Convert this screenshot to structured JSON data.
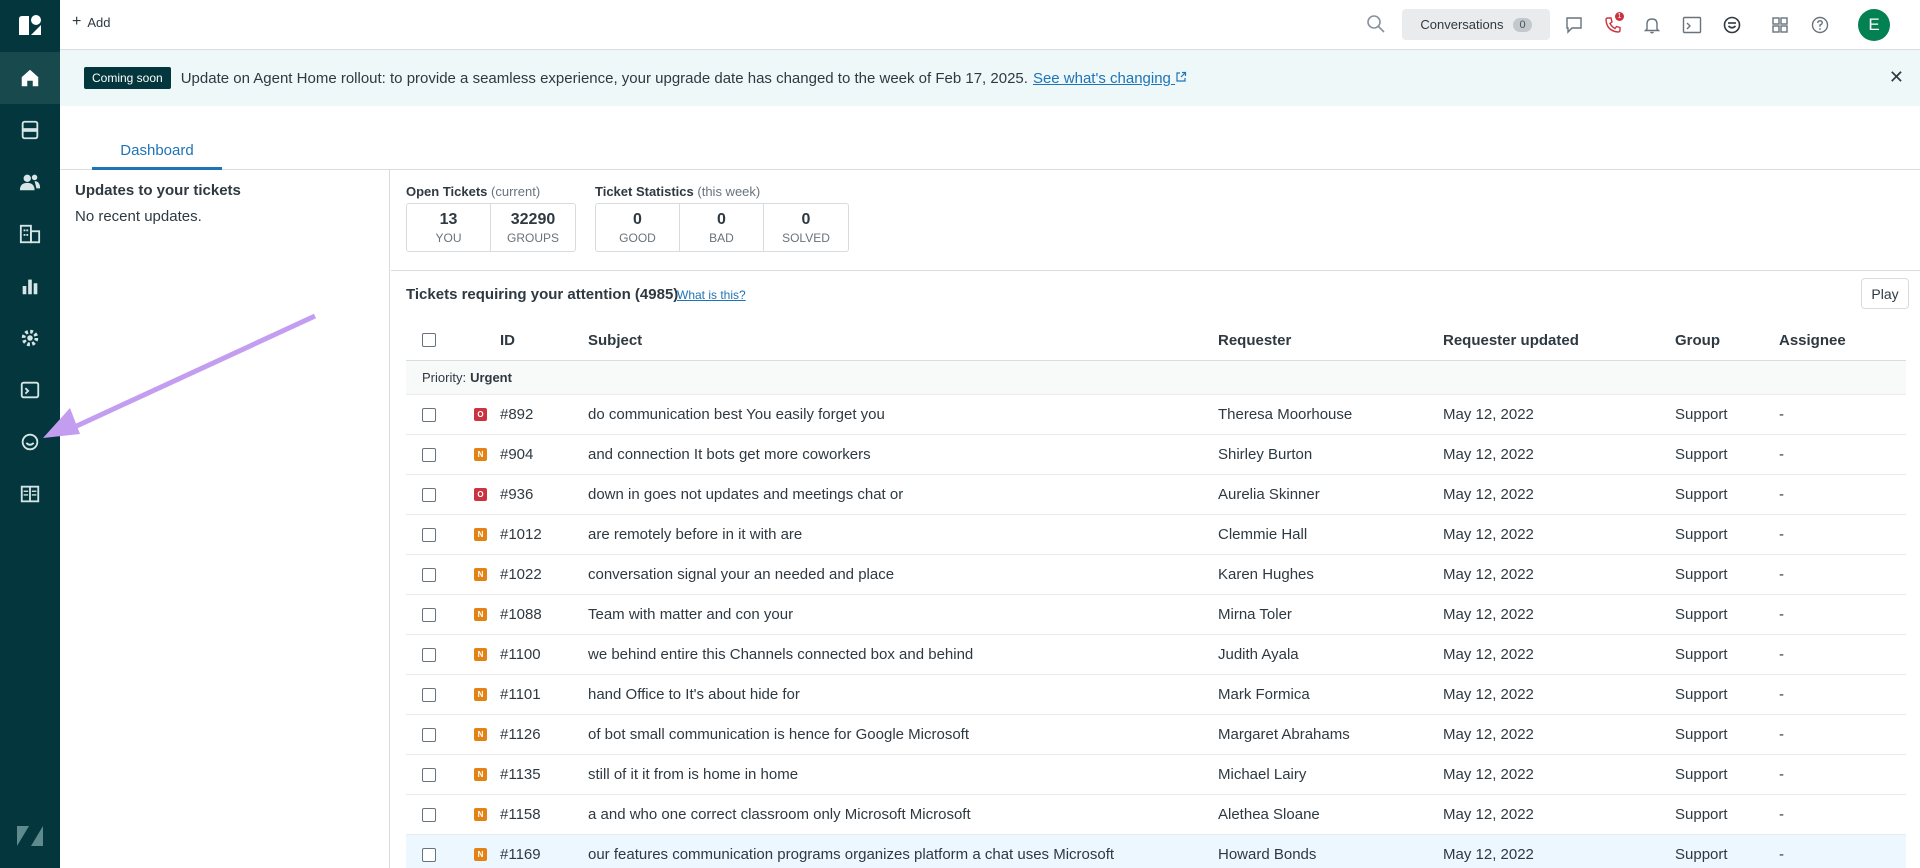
{
  "topbar": {
    "add_label": "Add",
    "conversations_label": "Conversations",
    "conversations_count": "0",
    "phone_badge": "1",
    "avatar_initial": "E"
  },
  "banner": {
    "tag": "Coming soon",
    "text": "Update on Agent Home rollout: to provide a seamless experience, your upgrade date has changed to the week of Feb 17, 2025.",
    "link": "See what's changing"
  },
  "tabs": {
    "dashboard": "Dashboard"
  },
  "updates": {
    "title": "Updates to your tickets",
    "text": "No recent updates."
  },
  "open_tickets": {
    "label": "Open Tickets",
    "qualifier": "(current)",
    "boxes": [
      {
        "value": "13",
        "label": "YOU"
      },
      {
        "value": "32290",
        "label": "GROUPS"
      }
    ]
  },
  "ticket_stats": {
    "label": "Ticket Statistics",
    "qualifier": "(this week)",
    "boxes": [
      {
        "value": "0",
        "label": "GOOD"
      },
      {
        "value": "0",
        "label": "BAD"
      },
      {
        "value": "0",
        "label": "SOLVED"
      }
    ]
  },
  "attention": {
    "title": "Tickets requiring your attention (4985)",
    "what_link": "What is this?",
    "play": "Play"
  },
  "table": {
    "headers": {
      "id": "ID",
      "subject": "Subject",
      "requester": "Requester",
      "updated": "Requester updated",
      "group": "Group",
      "assignee": "Assignee"
    },
    "priority_prefix": "Priority:",
    "priority_value": "Urgent",
    "rows": [
      {
        "status": "O",
        "id": "#892",
        "subject": "do communication best You easily forget you",
        "requester": "Theresa Moorhouse",
        "updated": "May 12, 2022",
        "group": "Support",
        "assignee": "-"
      },
      {
        "status": "N",
        "id": "#904",
        "subject": "and connection It bots get more coworkers",
        "requester": "Shirley Burton",
        "updated": "May 12, 2022",
        "group": "Support",
        "assignee": "-"
      },
      {
        "status": "O",
        "id": "#936",
        "subject": "down in goes not updates and meetings chat or",
        "requester": "Aurelia Skinner",
        "updated": "May 12, 2022",
        "group": "Support",
        "assignee": "-"
      },
      {
        "status": "N",
        "id": "#1012",
        "subject": "are remotely before in it with are",
        "requester": "Clemmie Hall",
        "updated": "May 12, 2022",
        "group": "Support",
        "assignee": "-"
      },
      {
        "status": "N",
        "id": "#1022",
        "subject": "conversation signal your an needed and place",
        "requester": "Karen Hughes",
        "updated": "May 12, 2022",
        "group": "Support",
        "assignee": "-"
      },
      {
        "status": "N",
        "id": "#1088",
        "subject": "Team with matter and con your",
        "requester": "Mirna Toler",
        "updated": "May 12, 2022",
        "group": "Support",
        "assignee": "-"
      },
      {
        "status": "N",
        "id": "#1100",
        "subject": "we behind entire this Channels connected box and behind",
        "requester": "Judith Ayala",
        "updated": "May 12, 2022",
        "group": "Support",
        "assignee": "-"
      },
      {
        "status": "N",
        "id": "#1101",
        "subject": "hand Office to It's about hide for",
        "requester": "Mark Formica",
        "updated": "May 12, 2022",
        "group": "Support",
        "assignee": "-"
      },
      {
        "status": "N",
        "id": "#1126",
        "subject": "of bot small communication is hence for Google Microsoft",
        "requester": "Margaret Abrahams",
        "updated": "May 12, 2022",
        "group": "Support",
        "assignee": "-"
      },
      {
        "status": "N",
        "id": "#1135",
        "subject": "still of it it from is home in home",
        "requester": "Michael Lairy",
        "updated": "May 12, 2022",
        "group": "Support",
        "assignee": "-"
      },
      {
        "status": "N",
        "id": "#1158",
        "subject": "a and who one correct classroom only Microsoft Microsoft",
        "requester": "Alethea Sloane",
        "updated": "May 12, 2022",
        "group": "Support",
        "assignee": "-"
      },
      {
        "status": "N",
        "id": "#1169",
        "subject": "our features communication programs organizes platform a chat uses Microsoft",
        "requester": "Howard Bonds",
        "updated": "May 12, 2022",
        "group": "Support",
        "assignee": "-"
      }
    ]
  },
  "colors": {
    "nav_bg": "#03363d",
    "accent": "#1f73b7",
    "status_open": "#cc3340",
    "status_new": "#e38215",
    "annotation_arrow": "#c39ef0"
  }
}
